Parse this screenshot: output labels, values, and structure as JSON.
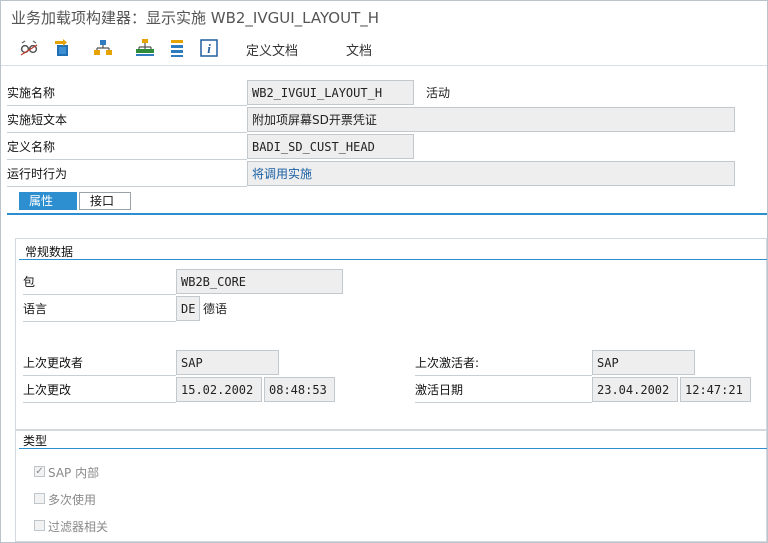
{
  "window": {
    "title": "业务加载项构建器：显示实施 WB2_IVGUI_LAYOUT_H"
  },
  "toolbar": {
    "icons": [
      "glasses-icon",
      "switch-icon",
      "hierarchy-icon",
      "tree-icon",
      "list-icon",
      "info-icon"
    ],
    "menu_definition_docs": "定义文档",
    "menu_docs": "文档"
  },
  "header_fields": {
    "impl_name_label": "实施名称",
    "impl_name_value": "WB2_IVGUI_LAYOUT_H",
    "impl_status": "活动",
    "impl_short_text_label": "实施短文本",
    "impl_short_text_value": "附加项屏幕SD开票凭证",
    "definition_name_label": "定义名称",
    "definition_name_value": "BADI_SD_CUST_HEAD",
    "runtime_behavior_label": "运行时行为",
    "runtime_behavior_value": "将调用实施"
  },
  "tabs": [
    {
      "label": "属性",
      "active": true
    },
    {
      "label": "接口",
      "active": false
    }
  ],
  "general_data": {
    "title": "常规数据",
    "package_label": "包",
    "package_value": "WB2B_CORE",
    "language_label": "语言",
    "language_code": "DE",
    "language_name": "德语",
    "last_changed_by_label": "上次更改者",
    "last_changed_by_value": "SAP",
    "last_changed_label": "上次更改",
    "last_changed_date": "15.02.2002",
    "last_changed_time": "08:48:53",
    "last_activated_by_label": "上次激活者:",
    "last_activated_by_value": "SAP",
    "activation_date_label": "激活日期",
    "activation_date": "23.04.2002",
    "activation_time": "12:47:21"
  },
  "type_section": {
    "title": "类型",
    "options": [
      {
        "label": "SAP 内部",
        "checked": true
      },
      {
        "label": "多次使用",
        "checked": false
      },
      {
        "label": "过滤器相关",
        "checked": false
      }
    ]
  },
  "colors": {
    "accent": "#2d8fd0",
    "link": "#1a5fa3",
    "field_bg": "#eeeeee"
  }
}
